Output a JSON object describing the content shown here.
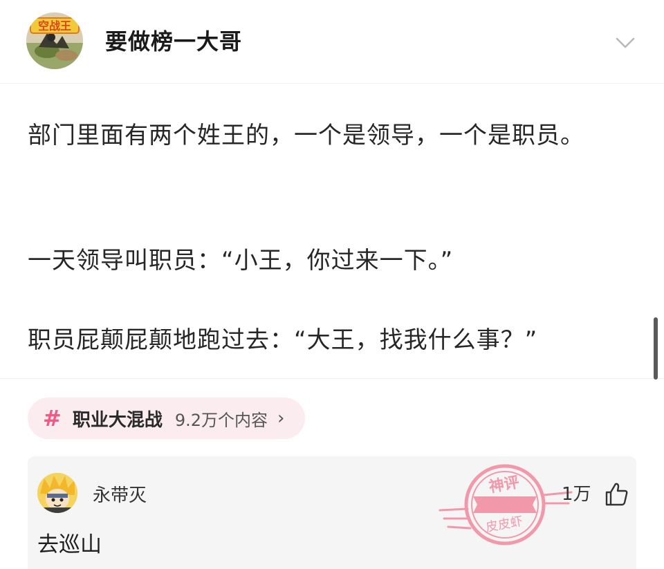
{
  "header": {
    "avatar_badge_text": "空战王",
    "username": "要做榜一大哥",
    "collapse_icon": "chevron-down-icon"
  },
  "post": {
    "paragraphs": [
      "部门里面有两个姓王的，一个是领导，一个是职员。",
      "一天领导叫职员：“小王，你过来一下。”",
      "职员屁颠屁颠地跑过去：“大王，找我什么事？”"
    ]
  },
  "topic": {
    "hash_symbol": "#",
    "name": "职业大混战",
    "count": "9.2万个内容",
    "arrow": "›",
    "accent_color": "#ef5a86",
    "background_color": "#fbecf0"
  },
  "comment": {
    "author": "永带灭",
    "text": "去巡山",
    "like_count": "1万",
    "like_icon": "thumbs-up-icon",
    "stamp": {
      "top_text": "神评",
      "bottom_text": "皮皮虾",
      "color": "#f07a93"
    }
  }
}
